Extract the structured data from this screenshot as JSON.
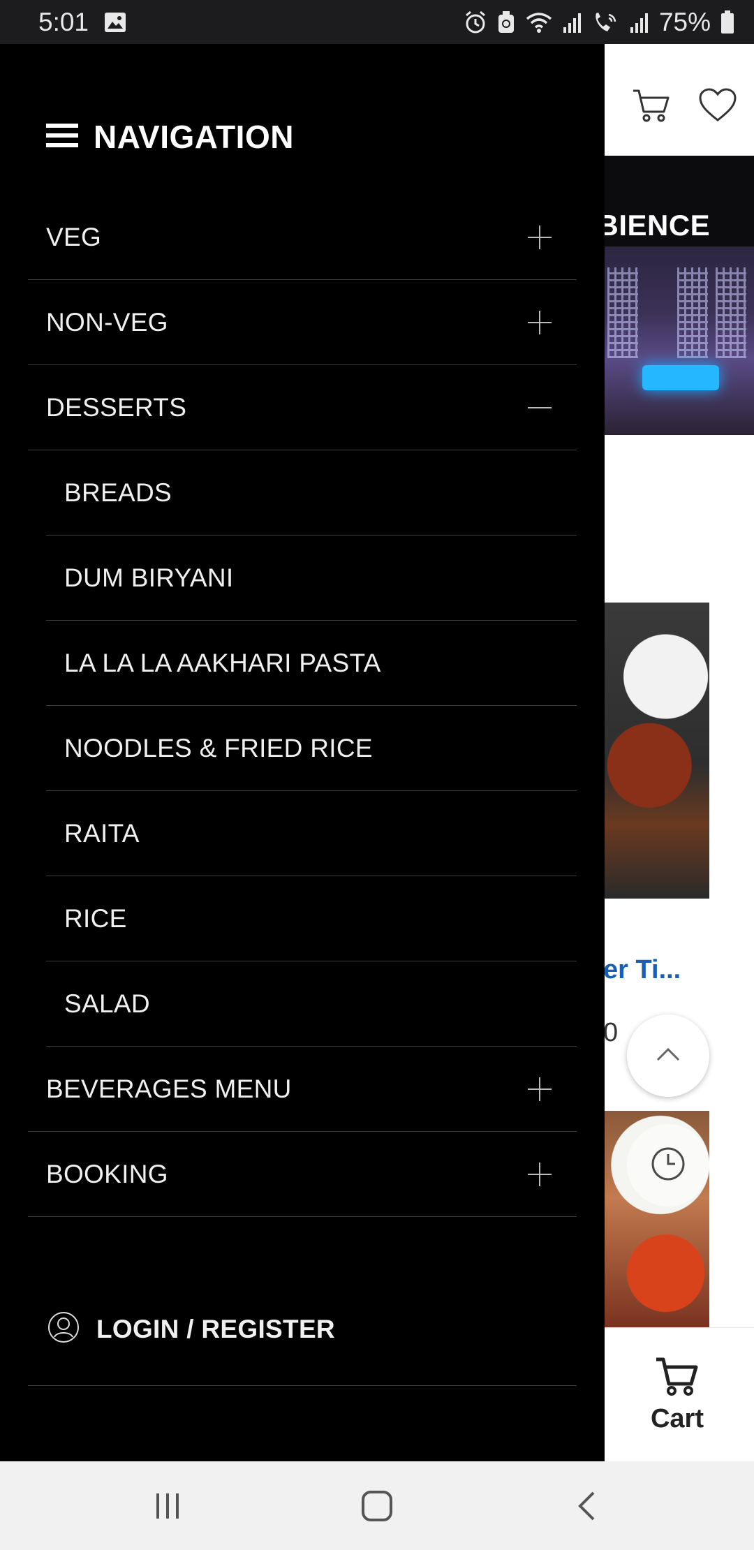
{
  "status_bar": {
    "time": "5:01",
    "battery": "75%",
    "icons": [
      "gallery-icon",
      "alarm-icon",
      "recycle-icon",
      "wifi-icon",
      "signal-icon",
      "volte-call-icon",
      "signal-icon",
      "battery-icon"
    ]
  },
  "background_page": {
    "header_icons": [
      "cart-icon",
      "heart-icon"
    ],
    "banner_title": "MBIENCE",
    "product_name": "er Ti...",
    "product_price": "0",
    "bottom_cart_label": "Cart"
  },
  "drawer": {
    "title": "NAVIGATION",
    "items": [
      {
        "label": "VEG",
        "toggle": "plus"
      },
      {
        "label": "NON-VEG",
        "toggle": "plus"
      },
      {
        "label": "DESSERTS",
        "toggle": "minus"
      },
      {
        "label": "BREADS",
        "sub": true
      },
      {
        "label": "DUM BIRYANI",
        "sub": true
      },
      {
        "label": "LA LA LA AAKHARI PASTA",
        "sub": true
      },
      {
        "label": "NOODLES & FRIED RICE",
        "sub": true
      },
      {
        "label": "RAITA",
        "sub": true
      },
      {
        "label": "RICE",
        "sub": true
      },
      {
        "label": "SALAD",
        "sub": true
      },
      {
        "label": "BEVERAGES MENU",
        "toggle": "plus"
      },
      {
        "label": "BOOKING",
        "toggle": "plus"
      }
    ],
    "login_label": "LOGIN / REGISTER"
  },
  "colors": {
    "drawer_bg": "#000000",
    "divider": "#3c3c3c",
    "link_blue": "#1a5fb4",
    "status_bar_bg": "#1c1c1e",
    "nav_bar_bg": "#f1f1f1"
  }
}
